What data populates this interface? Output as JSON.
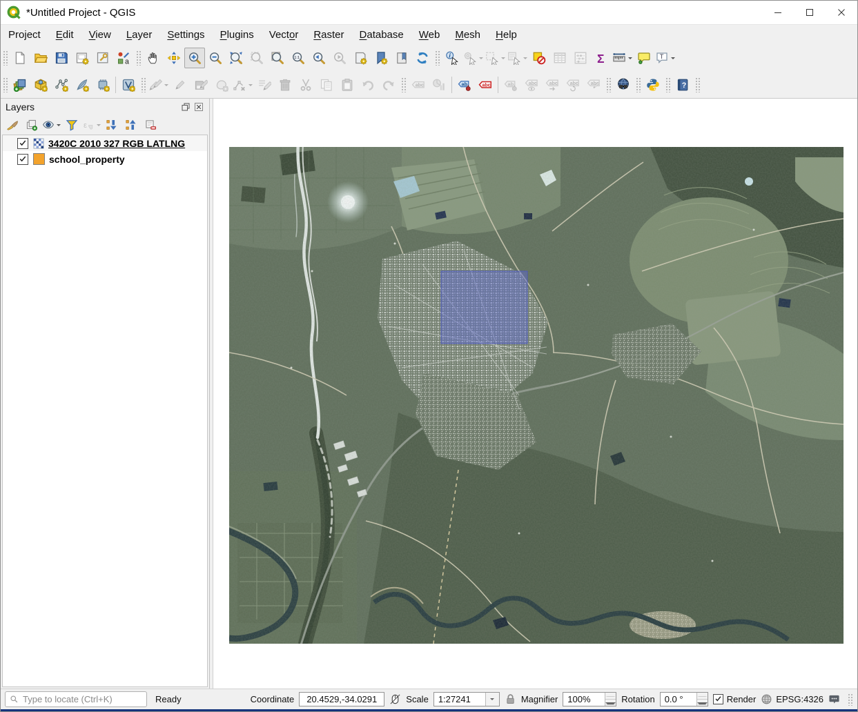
{
  "window": {
    "title": "*Untitled Project - QGIS"
  },
  "menu_items": [
    {
      "label": "Project",
      "accel": 3
    },
    {
      "label": "Edit",
      "accel": 0
    },
    {
      "label": "View",
      "accel": 0
    },
    {
      "label": "Layer",
      "accel": 0
    },
    {
      "label": "Settings",
      "accel": 0
    },
    {
      "label": "Plugins",
      "accel": 0
    },
    {
      "label": "Vector",
      "accel": 4
    },
    {
      "label": "Raster",
      "accel": 0
    },
    {
      "label": "Database",
      "accel": 0
    },
    {
      "label": "Web",
      "accel": 0
    },
    {
      "label": "Mesh",
      "accel": 0
    },
    {
      "label": "Help",
      "accel": 0
    }
  ],
  "icon_glyphs": {
    "sigma": "Σ",
    "abc": "abc",
    "ab": "ab",
    "annotation_t": "T",
    "native_zoom": "1:1",
    "expression_epsilon": "ε",
    "identify_i": "i",
    "help_q": "?",
    "style_a": "a"
  },
  "toolbars": {
    "primary": [
      {
        "t": "g"
      },
      {
        "n": "new-project",
        "i": "page"
      },
      {
        "n": "open-project",
        "i": "folder"
      },
      {
        "n": "save-project",
        "i": "floppy"
      },
      {
        "n": "new-print-layout",
        "i": "layout-star"
      },
      {
        "n": "show-layout-manager",
        "i": "layout-mgr"
      },
      {
        "n": "style-manager",
        "i": "style"
      },
      {
        "t": "g"
      },
      {
        "n": "pan-map",
        "i": "hand"
      },
      {
        "n": "pan-map-to-selection",
        "i": "pan-arrows"
      },
      {
        "n": "zoom-in",
        "i": "mag-plus",
        "p": 1
      },
      {
        "n": "zoom-out",
        "i": "mag-minus"
      },
      {
        "n": "zoom-full",
        "i": "mag-full"
      },
      {
        "n": "zoom-to-selection",
        "i": "mag-sel",
        "d": 1
      },
      {
        "n": "zoom-to-layer",
        "i": "mag-layer"
      },
      {
        "n": "zoom-to-native-resolution",
        "i": "mag-native"
      },
      {
        "n": "zoom-last",
        "i": "mag-last"
      },
      {
        "n": "zoom-next",
        "i": "mag-next",
        "d": 1
      },
      {
        "n": "new-map-view",
        "i": "map-view"
      },
      {
        "n": "new-spatial-bookmark",
        "i": "bookmark-new"
      },
      {
        "n": "show-spatial-bookmarks",
        "i": "bookmark-show"
      },
      {
        "n": "refresh-map",
        "i": "refresh"
      },
      {
        "t": "g"
      },
      {
        "n": "identify-features",
        "i": "identify"
      },
      {
        "n": "run-feature-action",
        "i": "action",
        "d": 1,
        "a": 1
      },
      {
        "n": "select-features",
        "i": "select",
        "d": 1,
        "a": 1
      },
      {
        "n": "select-features-by-value",
        "i": "select-form",
        "d": 1,
        "a": 1
      },
      {
        "n": "deselect-features-from-all-layers",
        "i": "deselect-all"
      },
      {
        "n": "open-attribute-table",
        "i": "attr-table",
        "d": 1
      },
      {
        "n": "field-calculator",
        "i": "abacus",
        "d": 1
      },
      {
        "n": "statistical-summary",
        "i": "sigma"
      },
      {
        "n": "measure-line",
        "i": "measure",
        "a": 1
      },
      {
        "n": "map-tips",
        "i": "maptip"
      },
      {
        "n": "text-annotation",
        "i": "annotation",
        "a": 1
      }
    ],
    "secondary": [
      {
        "t": "g"
      },
      {
        "n": "open-data-source-manager",
        "i": "dsm"
      },
      {
        "n": "new-geopackage-layer",
        "i": "geopackage"
      },
      {
        "n": "new-shapefile-layer",
        "i": "shapefile"
      },
      {
        "n": "new-spatialite-layer",
        "i": "spatialite"
      },
      {
        "n": "new-mesh-layer",
        "i": "memory"
      },
      {
        "t": "s"
      },
      {
        "n": "new-virtual-layer",
        "i": "virtual"
      },
      {
        "t": "g"
      },
      {
        "n": "current-edits",
        "i": "pencils",
        "d": 1,
        "a": 1
      },
      {
        "n": "toggle-editing",
        "i": "pencil",
        "d": 1
      },
      {
        "n": "save-layer-edits",
        "i": "save-edits",
        "d": 1
      },
      {
        "n": "add-feature",
        "i": "add-feature",
        "d": 1
      },
      {
        "n": "vertex-tool",
        "i": "vertex",
        "d": 1,
        "a": 1
      },
      {
        "n": "modify-attributes",
        "i": "multiedit",
        "d": 1
      },
      {
        "n": "delete-selected",
        "i": "trash",
        "d": 1
      },
      {
        "n": "cut-features",
        "i": "cut",
        "d": 1
      },
      {
        "n": "copy-features",
        "i": "copy",
        "d": 1
      },
      {
        "n": "paste-features",
        "i": "paste",
        "d": 1
      },
      {
        "n": "undo",
        "i": "undo",
        "d": 1
      },
      {
        "n": "redo",
        "i": "redo",
        "d": 1
      },
      {
        "t": "g"
      },
      {
        "n": "show-unplaced-labels",
        "i": "abc-tag",
        "d": 1
      },
      {
        "n": "diagram-options",
        "i": "diagram",
        "d": 1
      },
      {
        "t": "s"
      },
      {
        "n": "layer-labeling-options",
        "i": "ab-blue"
      },
      {
        "n": "layer-diagram-options",
        "i": "abc-red"
      },
      {
        "t": "s"
      },
      {
        "n": "pin-unpin-labels",
        "i": "ab-pin",
        "d": 1
      },
      {
        "n": "show-hide-labels",
        "i": "abc-eye",
        "d": 1
      },
      {
        "n": "move-label",
        "i": "abc-arrow",
        "d": 1
      },
      {
        "n": "rotate-label",
        "i": "abc-rotate",
        "d": 1
      },
      {
        "n": "change-label",
        "i": "abc-edit",
        "d": 1
      },
      {
        "t": "g"
      },
      {
        "n": "metasearch",
        "i": "metasearch"
      },
      {
        "t": "g"
      },
      {
        "n": "python-console",
        "i": "python"
      },
      {
        "t": "g"
      },
      {
        "n": "help-contents",
        "i": "help"
      },
      {
        "t": "g"
      }
    ],
    "layers_panel": [
      {
        "n": "open-layer-styling",
        "i": "brush"
      },
      {
        "n": "add-group",
        "i": "addgroup"
      },
      {
        "n": "manage-map-themes",
        "i": "themes",
        "a": 1
      },
      {
        "n": "filter-legend",
        "i": "funnel"
      },
      {
        "n": "filter-legend-by-expression",
        "i": "expression",
        "d": 1,
        "a": 1
      },
      {
        "n": "expand-all",
        "i": "expand"
      },
      {
        "n": "collapse-all",
        "i": "collapse"
      },
      {
        "n": "remove-layer-group",
        "i": "removelayer"
      }
    ]
  },
  "layers_panel": {
    "title": "Layers",
    "layers": [
      {
        "name": "3420C 2010 327 RGB LATLNG",
        "checked": true,
        "selected": true,
        "kind": "raster"
      },
      {
        "name": "school_property",
        "checked": true,
        "selected": false,
        "kind": "vector",
        "swatch": "#f3a32c"
      }
    ]
  },
  "map": {
    "overlay_layer": "school_property",
    "overlay_fill": "#5560dd",
    "overlay_stroke": "#3d49c9"
  },
  "statusbar": {
    "locator_placeholder": "Type to locate (Ctrl+K)",
    "status": "Ready",
    "coordinate_label": "Coordinate",
    "coordinate_value": "20.4529,-34.0291",
    "scale_label": "Scale",
    "scale_value": "1:27241",
    "magnifier_label": "Magnifier",
    "magnifier_value": "100%",
    "rotation_label": "Rotation",
    "rotation_value": "0.0 °",
    "render_label": "Render",
    "crs_label": "EPSG:4326"
  }
}
